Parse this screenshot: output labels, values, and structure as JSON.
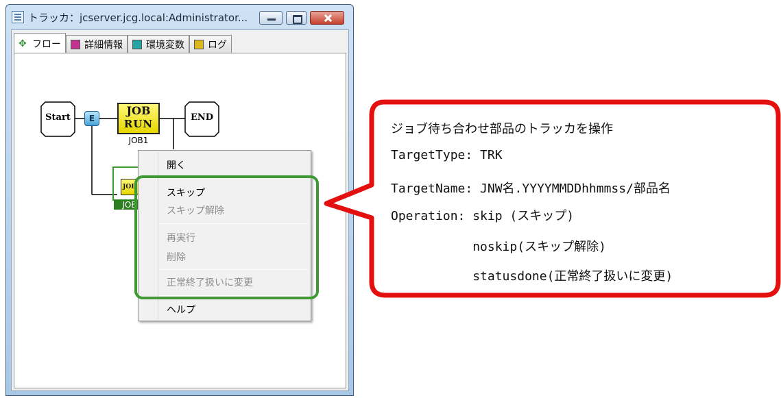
{
  "window": {
    "title": "トラッカ：jcserver.jcg.local:Administrator..."
  },
  "tabs": [
    {
      "label": "フロー",
      "icon": "flow-icon"
    },
    {
      "label": "詳細情報",
      "icon": "detail-icon"
    },
    {
      "label": "環境変数",
      "icon": "env-icon"
    },
    {
      "label": "ログ",
      "icon": "log-icon"
    }
  ],
  "flow": {
    "start_label": "Start",
    "end_label": "END",
    "job1_icon_top": "JOB",
    "job1_icon_bottom": "RUN",
    "job1_name": "JOB1",
    "job2_icon_text": "JOB",
    "job2_name": "JOB"
  },
  "context_menu": {
    "items": [
      {
        "label": "開く",
        "enabled": true
      },
      {
        "label": "スキップ",
        "enabled": true
      },
      {
        "label": "スキップ解除",
        "enabled": false
      },
      {
        "label": "再実行",
        "enabled": false
      },
      {
        "label": "削除",
        "enabled": false
      },
      {
        "label": "正常終了扱いに変更",
        "enabled": false
      },
      {
        "label": "ヘルプ",
        "enabled": true
      }
    ]
  },
  "callout": {
    "lines": [
      "ジョブ待ち合わせ部品のトラッカを操作",
      "TargetType: TRK",
      "TargetName: JNW名.YYYYMMDDhhmmss/部品名",
      "Operation: skip (スキップ)",
      "           noskip(スキップ解除)",
      "           statusdone(正常終了扱いに変更)"
    ],
    "border_color": "#e41010",
    "highlight_color": "#3f9a34"
  }
}
